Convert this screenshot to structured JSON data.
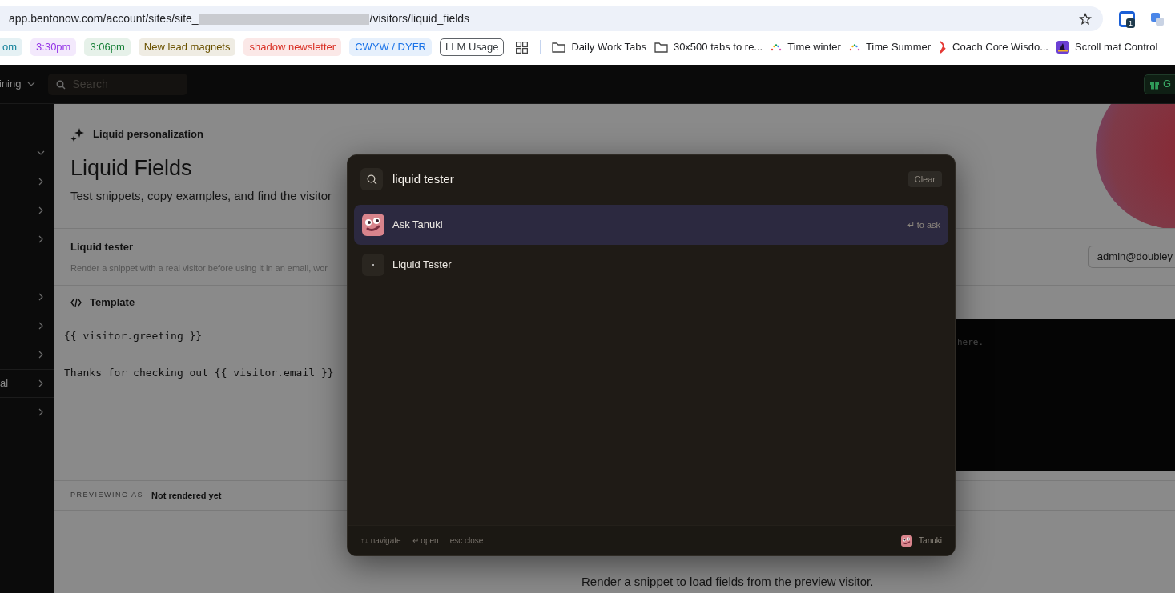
{
  "browser": {
    "url_start": "app.bentonow.com/account/sites/site_",
    "url_end": "/visitors/liquid_fields",
    "extension_badge": "1"
  },
  "bookmarks": [
    {
      "kind": "chip",
      "label": "om",
      "color": "#12829a"
    },
    {
      "kind": "chip",
      "label": "3:30pm",
      "color": "#9334e6"
    },
    {
      "kind": "chip",
      "label": "3:06pm",
      "color": "#188038"
    },
    {
      "kind": "chip",
      "label": "New lead magnets",
      "color": "#6b5200"
    },
    {
      "kind": "chip",
      "label": "shadow newsletter",
      "color": "#d93025"
    },
    {
      "kind": "chip",
      "label": "CWYW / DYFR",
      "color": "#1a73e8"
    },
    {
      "kind": "outline",
      "label": "LLM Usage"
    },
    {
      "kind": "apps"
    },
    {
      "kind": "folder",
      "label": "Daily Work Tabs"
    },
    {
      "kind": "folder",
      "label": "30x500 tabs to re..."
    },
    {
      "kind": "dots",
      "label": "Time winter"
    },
    {
      "kind": "dots",
      "label": "Time Summer"
    },
    {
      "kind": "bolt",
      "label": "Coach Core Wisdo..."
    },
    {
      "kind": "app",
      "label": "Scroll mat Control"
    }
  ],
  "topbar": {
    "workspace": "ining",
    "search_placeholder": "Search",
    "button": "G"
  },
  "sidebar": {
    "items": [
      {
        "expanded": true
      },
      {
        "expanded": false
      },
      {
        "expanded": false
      },
      {
        "expanded": false
      },
      {
        "expanded": false
      },
      {
        "expanded": false
      },
      {
        "expanded": false
      },
      {
        "label": "al",
        "expanded": false
      },
      {
        "expanded": false
      }
    ]
  },
  "header": {
    "eyebrow": "Liquid personalization",
    "title": "Liquid Fields",
    "subtitle": "Test snippets, copy examples, and find the visitor"
  },
  "tester": {
    "title": "Liquid tester",
    "description": "Render a snippet with a real visitor before using it in an email, wor",
    "visitor": "admin@doubley"
  },
  "template": {
    "title": "Template",
    "code": "{{ visitor.greeting }}\n\nThanks for checking out {{ visitor.email }}",
    "output": "here."
  },
  "preview": {
    "label": "PREVIEWING AS",
    "value": "Not rendered yet",
    "empty": "Render a snippet to load fields from the preview visitor."
  },
  "palette": {
    "query": "liquid tester",
    "clear": "Clear",
    "results": [
      {
        "kind": "assistant",
        "label": "Ask Tanuki",
        "selected": true,
        "key": "↵",
        "hint": "to ask"
      },
      {
        "kind": "page",
        "label": "Liquid Tester",
        "selected": false
      }
    ],
    "footer": [
      {
        "key": "↑↓",
        "label": "navigate"
      },
      {
        "key": "↵",
        "label": "open"
      },
      {
        "label": "esc close"
      }
    ],
    "brand": "Tanuki"
  }
}
